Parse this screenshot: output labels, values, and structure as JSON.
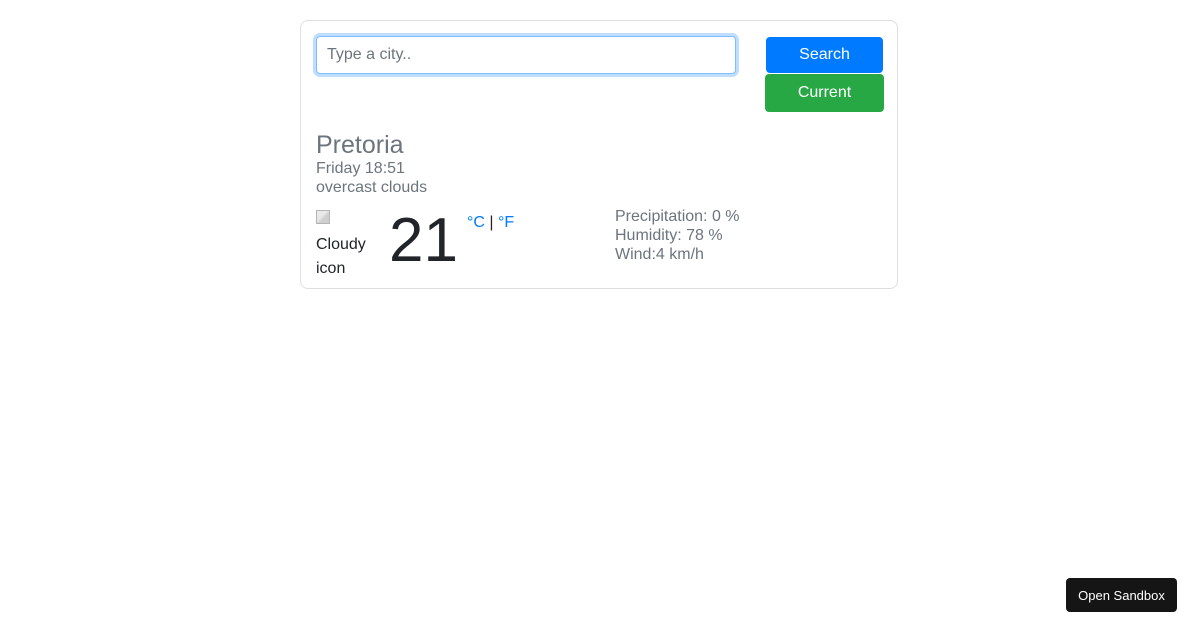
{
  "search": {
    "placeholder": "Type a city..",
    "value": "",
    "search_label": "Search",
    "current_label": "Current"
  },
  "weather": {
    "city": "Pretoria",
    "datetime": "Friday 18:51",
    "description": "overcast clouds",
    "icon_alt_line1": "Cloudy",
    "icon_alt_line2": "icon",
    "temperature": "21",
    "unit_celsius": "°C",
    "unit_separator": "|",
    "unit_fahrenheit": "°F",
    "precipitation": "Precipitation: 0 %",
    "humidity": "Humidity: 78 %",
    "wind": "Wind:4 km/h"
  },
  "sandbox": {
    "label": "Open Sandbox"
  },
  "colors": {
    "primary": "#007bff",
    "success": "#28a745",
    "muted": "#6c757d"
  }
}
